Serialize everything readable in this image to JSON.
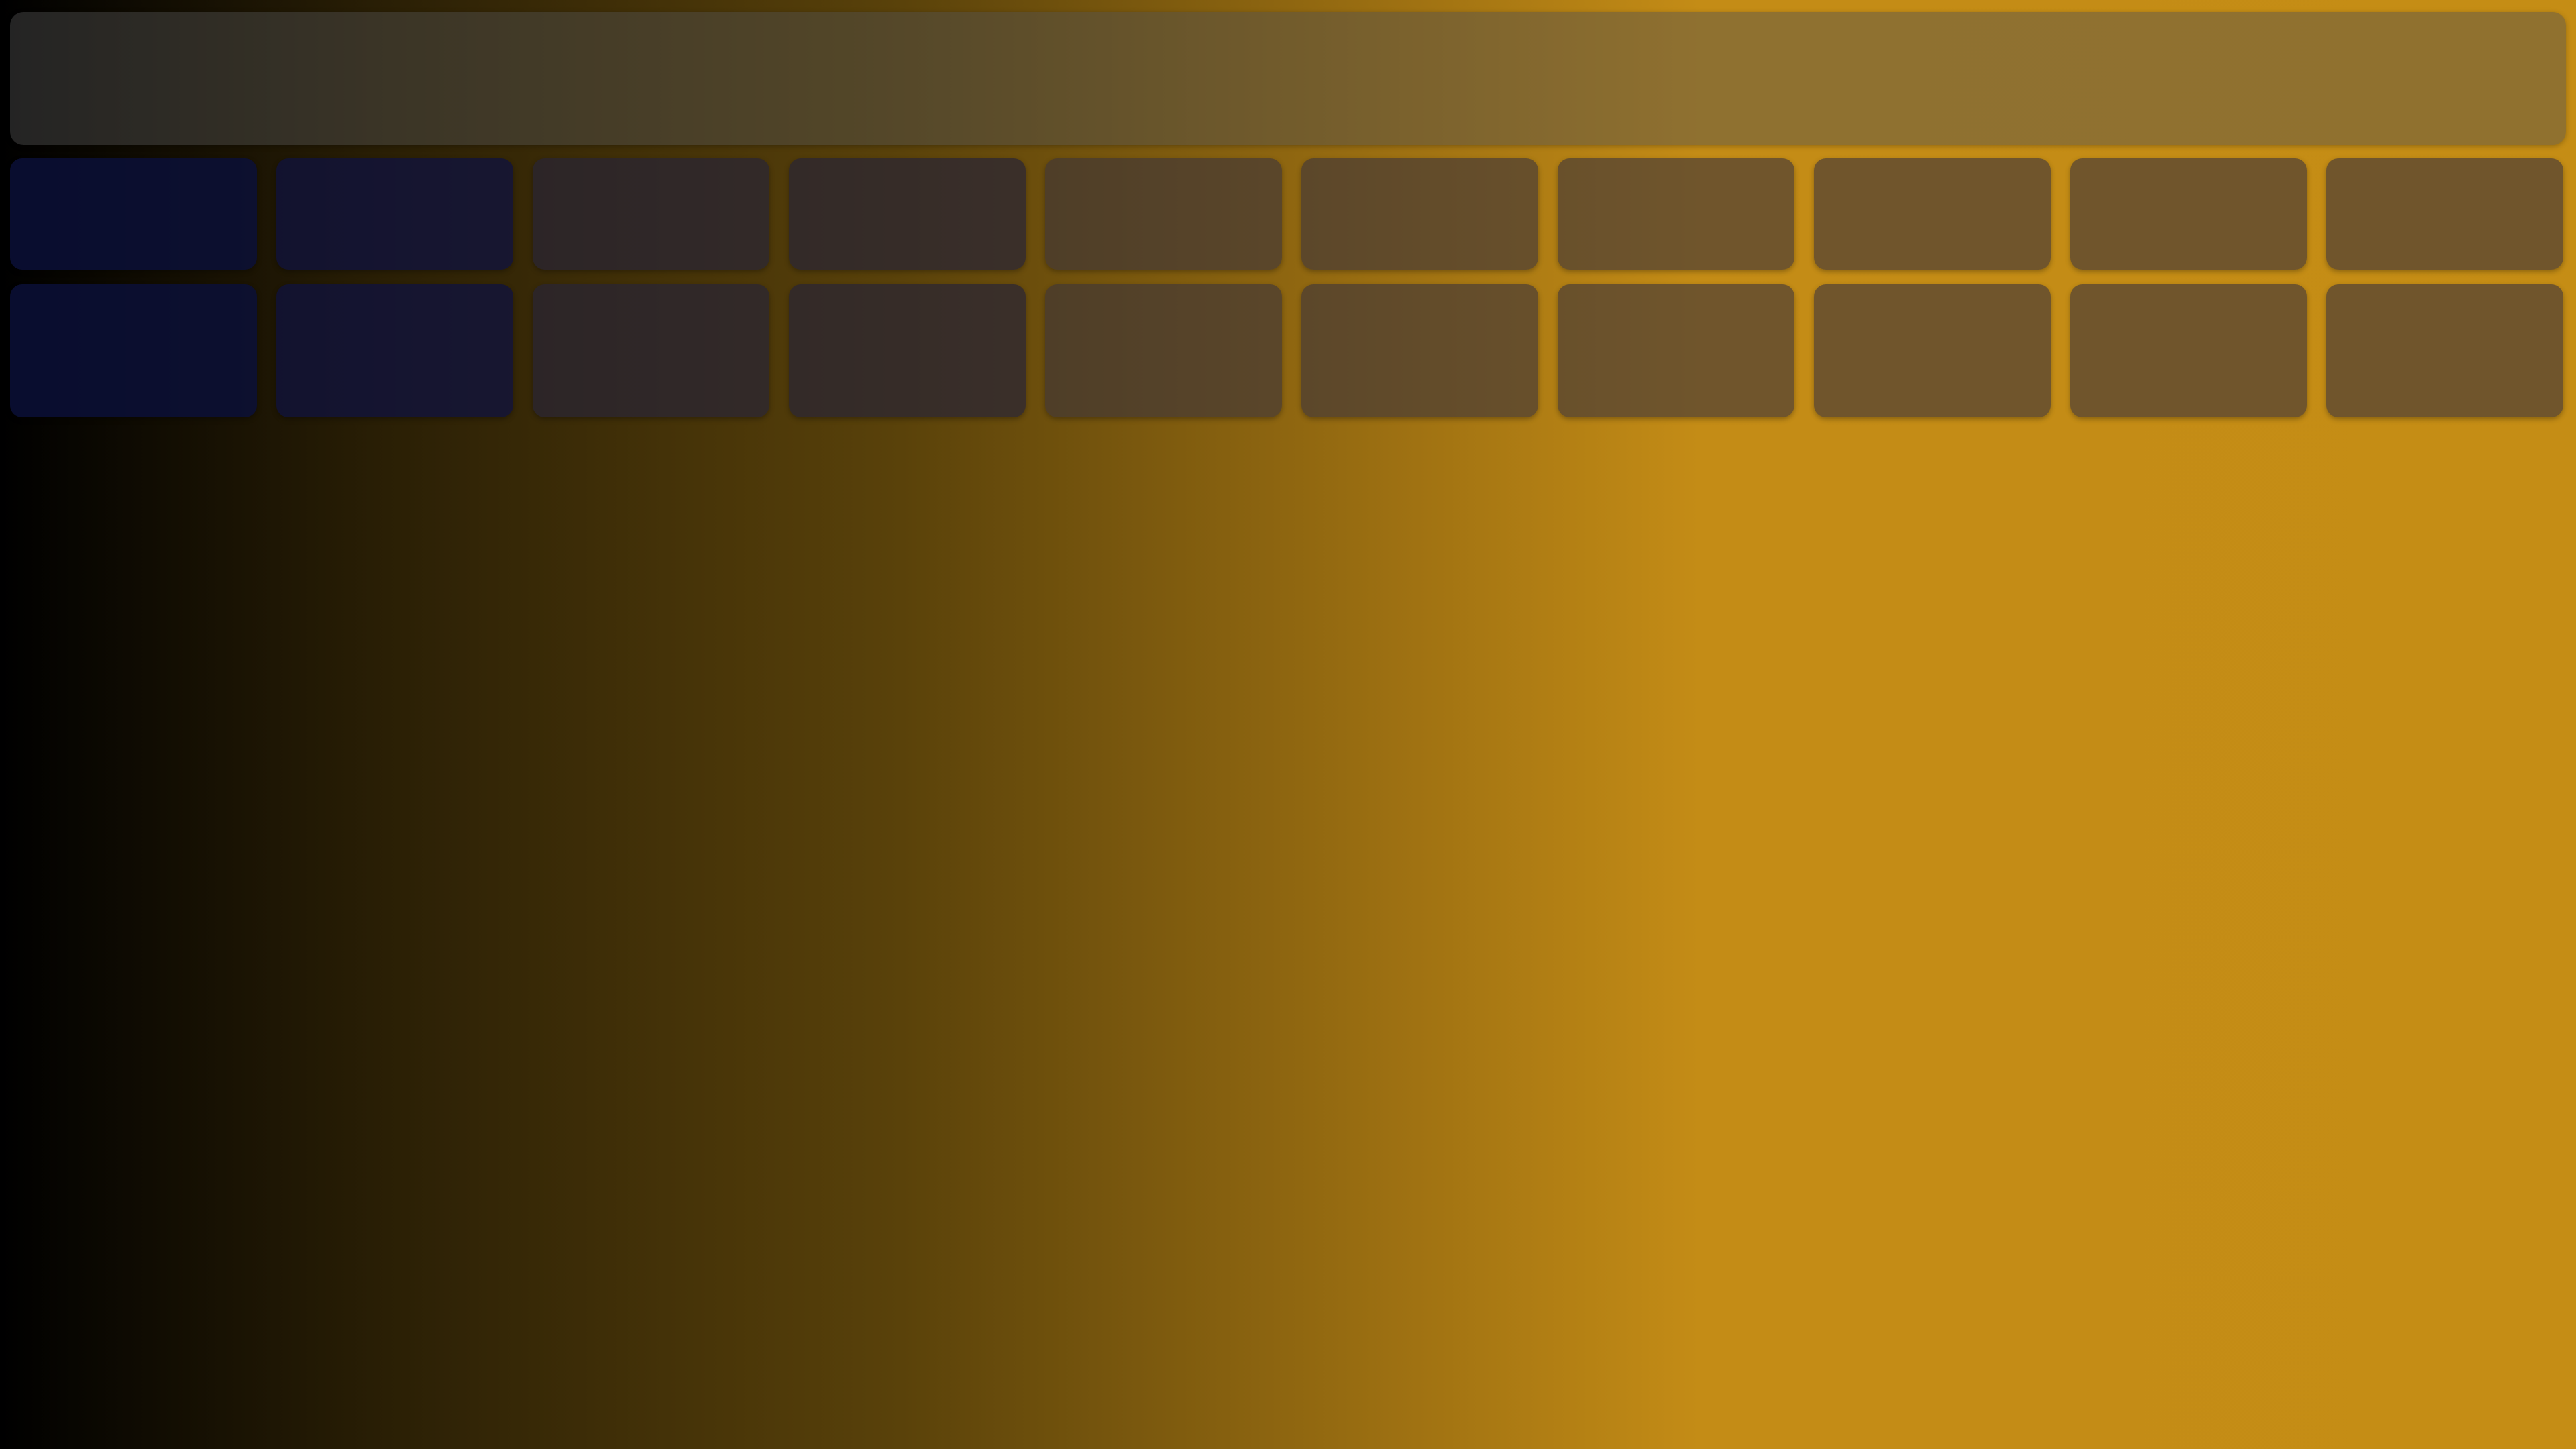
{
  "screen": {
    "background": "amber-gradient"
  },
  "top_bar": {
    "label": ""
  },
  "tiles": [
    {
      "id": "r1c1",
      "tone": "blue-1"
    },
    {
      "id": "r1c2",
      "tone": "blue-2"
    },
    {
      "id": "r1c3",
      "tone": "dark"
    },
    {
      "id": "r1c4",
      "tone": "dark"
    },
    {
      "id": "r1c5",
      "tone": "mid"
    },
    {
      "id": "r1c6",
      "tone": "mid"
    },
    {
      "id": "r1c7",
      "tone": "mid"
    },
    {
      "id": "r1c8",
      "tone": "mid"
    },
    {
      "id": "r1c9",
      "tone": "mid"
    },
    {
      "id": "r1c10",
      "tone": "mid"
    },
    {
      "id": "r2c1",
      "tone": "blue-1"
    },
    {
      "id": "r2c2",
      "tone": "blue-2"
    },
    {
      "id": "r2c3",
      "tone": "dark"
    },
    {
      "id": "r2c4",
      "tone": "dark"
    },
    {
      "id": "r2c5",
      "tone": "mid"
    },
    {
      "id": "r2c6",
      "tone": "mid"
    },
    {
      "id": "r2c7",
      "tone": "mid"
    },
    {
      "id": "r2c8",
      "tone": "mid"
    },
    {
      "id": "r2c9",
      "tone": "mid"
    },
    {
      "id": "r2c10",
      "tone": "mid"
    }
  ]
}
